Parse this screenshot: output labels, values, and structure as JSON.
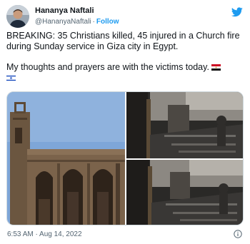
{
  "author": {
    "display_name": "Hananya Naftali",
    "handle": "@HananyaNaftali",
    "separator": "·",
    "follow_label": "Follow"
  },
  "tweet": {
    "paragraph_1": "BREAKING: 35 Christians killed, 45 injured in a Church fire during Sunday service in Giza city in Egypt.",
    "paragraph_2": "My thoughts and prayers are with the victims today."
  },
  "timestamp": "6:53 AM · Aug 14, 2022",
  "icons": {
    "brand": "twitter-bird-icon",
    "info": "info-icon",
    "flag_1": "egypt-flag",
    "flag_2": "israel-flag"
  },
  "colors": {
    "accent": "#1d9bf0",
    "text": "#0f1419",
    "secondary": "#536471"
  }
}
